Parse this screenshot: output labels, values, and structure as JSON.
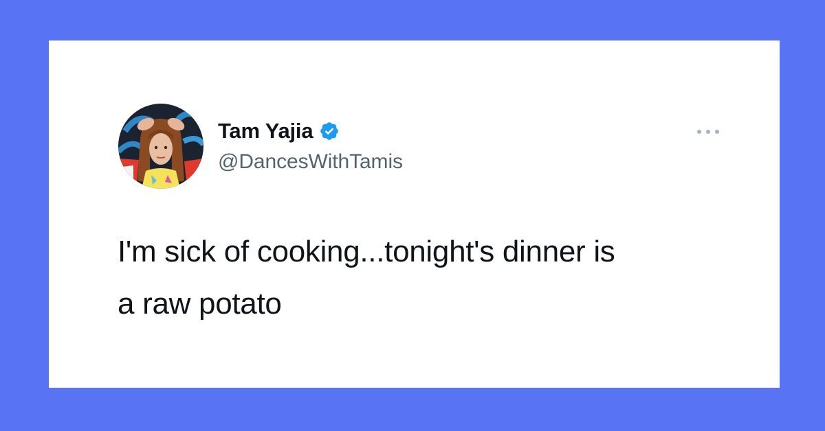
{
  "background_color": "#5874f5",
  "card_color": "#ffffff",
  "tweet": {
    "author": {
      "name": "Tam Yajia",
      "handle": "@DancesWithTamis",
      "verified": true,
      "verified_icon": "verified-badge-icon",
      "verified_color": "#1d9bf0"
    },
    "more_icon": "more-horizontal-icon",
    "text": "I'm sick of cooking...tonight's dinner is\na raw potato"
  },
  "colors": {
    "text_primary": "#0f1419",
    "text_secondary": "#536471"
  }
}
